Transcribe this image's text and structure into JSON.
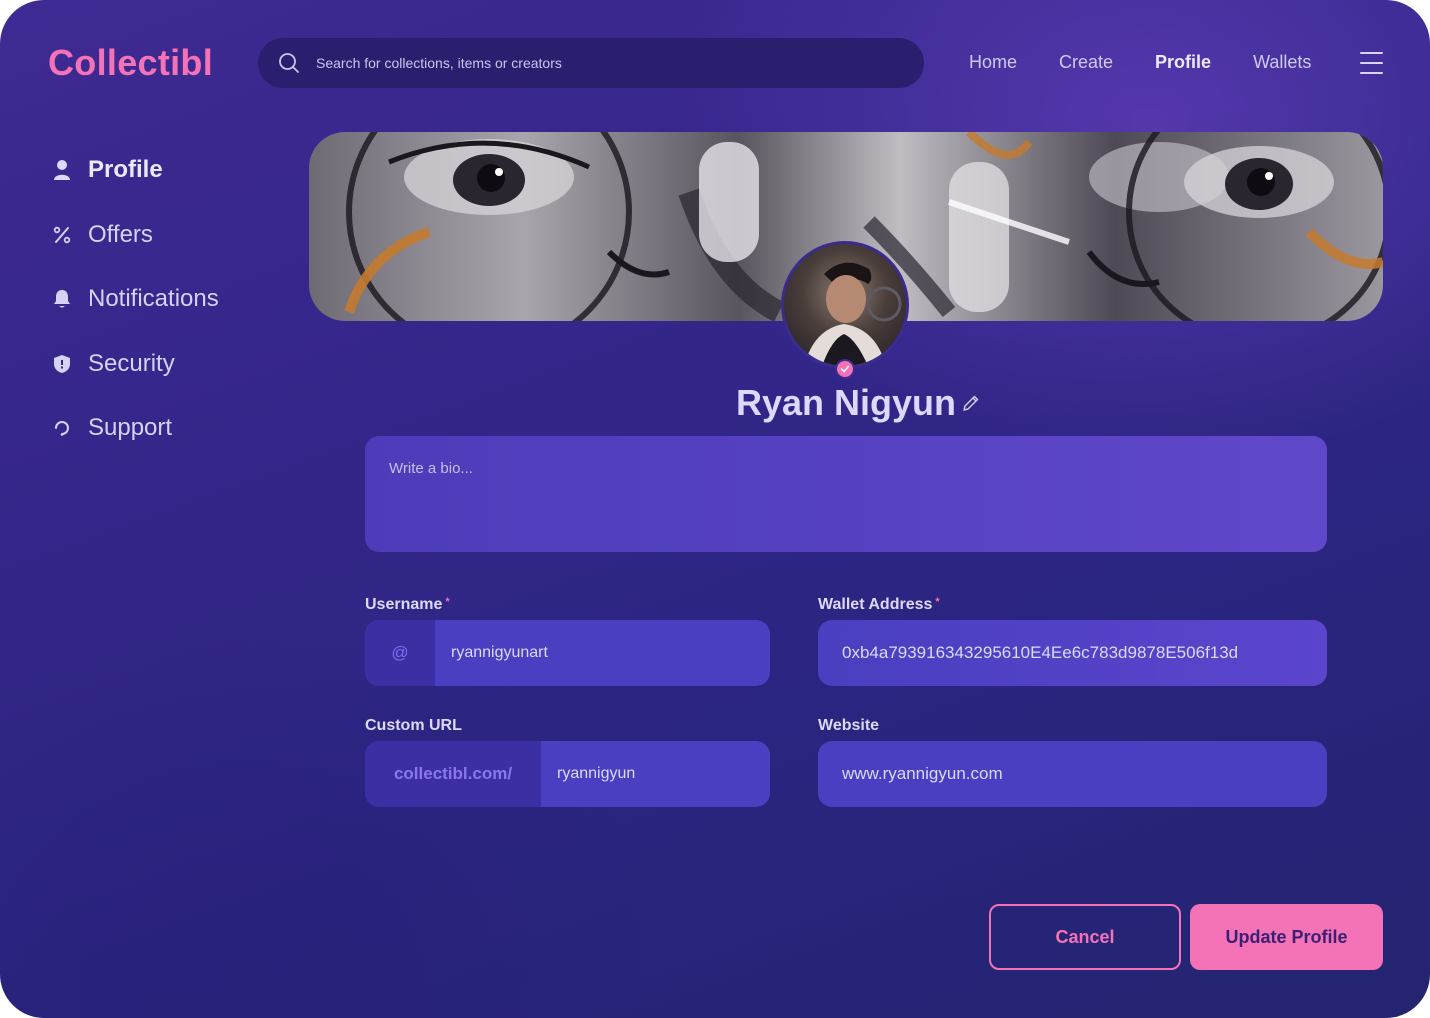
{
  "app": {
    "logo": "Collectibl",
    "accent_color": "#f472b6"
  },
  "header": {
    "search_placeholder": "Search for collections, items or creators",
    "nav": [
      {
        "label": "Home",
        "active": false
      },
      {
        "label": "Create",
        "active": false
      },
      {
        "label": "Profile",
        "active": true
      },
      {
        "label": "Wallets",
        "active": false
      }
    ],
    "menu_icon": "hamburger-icon"
  },
  "sidebar": {
    "items": [
      {
        "label": "Profile",
        "icon": "user-icon",
        "active": true
      },
      {
        "label": "Offers",
        "icon": "percent-icon",
        "active": false
      },
      {
        "label": "Notifications",
        "icon": "bell-icon",
        "active": false
      },
      {
        "label": "Security",
        "icon": "shield-icon",
        "active": false
      },
      {
        "label": "Support",
        "icon": "support-icon",
        "active": false
      }
    ]
  },
  "profile": {
    "name": "Ryan Nigyun",
    "bio_placeholder": "Write a bio...",
    "username_label": "Username",
    "username_prefix": "@",
    "username_value": "ryannigyunart",
    "wallet_label": "Wallet Address",
    "wallet_value": "0xb4a793916343295610E4Ee6c783d9878E506f13d",
    "custom_url_label": "Custom URL",
    "custom_url_prefix": "collectibl.com/",
    "custom_url_value": "ryannigyun",
    "website_label": "Website",
    "website_value": "www.ryannigyun.com",
    "required_mark": "*"
  },
  "actions": {
    "cancel_label": "Cancel",
    "update_label": "Update Profile"
  }
}
